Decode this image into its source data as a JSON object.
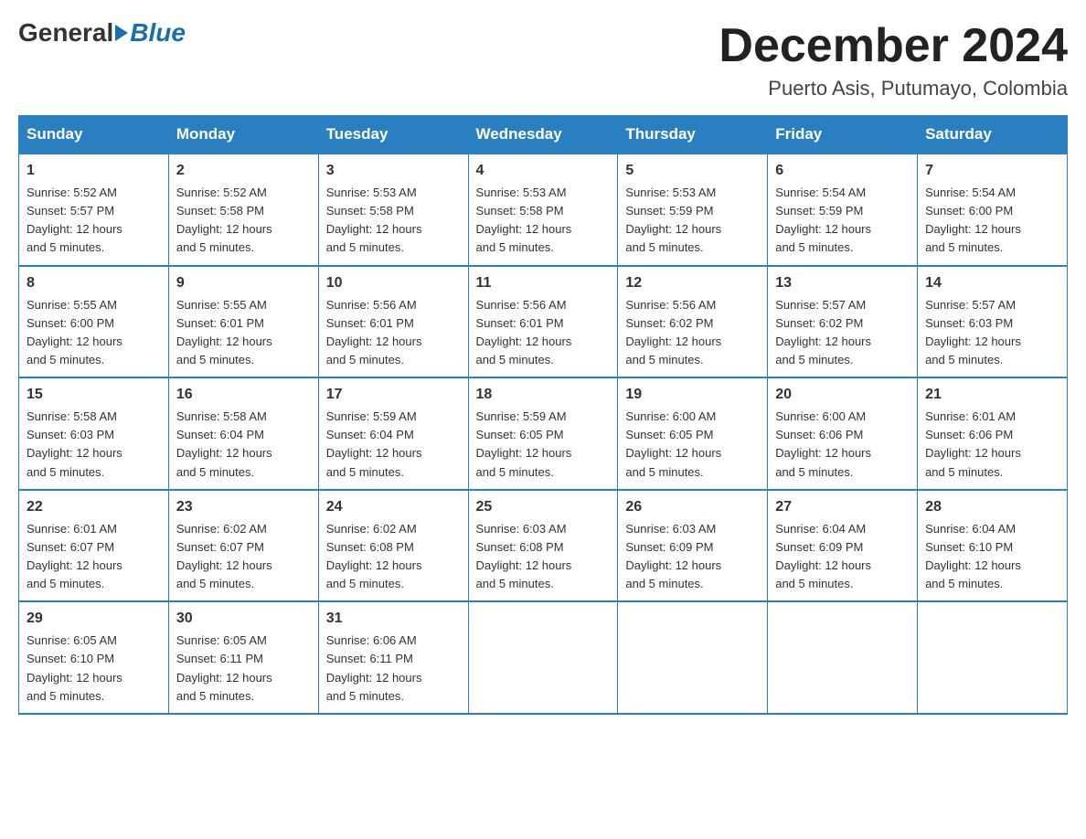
{
  "logo": {
    "general": "General",
    "blue": "Blue"
  },
  "title": "December 2024",
  "location": "Puerto Asis, Putumayo, Colombia",
  "days_header": [
    "Sunday",
    "Monday",
    "Tuesday",
    "Wednesday",
    "Thursday",
    "Friday",
    "Saturday"
  ],
  "weeks": [
    [
      {
        "day": "1",
        "sunrise": "5:52 AM",
        "sunset": "5:57 PM",
        "daylight": "12 hours and 5 minutes."
      },
      {
        "day": "2",
        "sunrise": "5:52 AM",
        "sunset": "5:58 PM",
        "daylight": "12 hours and 5 minutes."
      },
      {
        "day": "3",
        "sunrise": "5:53 AM",
        "sunset": "5:58 PM",
        "daylight": "12 hours and 5 minutes."
      },
      {
        "day": "4",
        "sunrise": "5:53 AM",
        "sunset": "5:58 PM",
        "daylight": "12 hours and 5 minutes."
      },
      {
        "day": "5",
        "sunrise": "5:53 AM",
        "sunset": "5:59 PM",
        "daylight": "12 hours and 5 minutes."
      },
      {
        "day": "6",
        "sunrise": "5:54 AM",
        "sunset": "5:59 PM",
        "daylight": "12 hours and 5 minutes."
      },
      {
        "day": "7",
        "sunrise": "5:54 AM",
        "sunset": "6:00 PM",
        "daylight": "12 hours and 5 minutes."
      }
    ],
    [
      {
        "day": "8",
        "sunrise": "5:55 AM",
        "sunset": "6:00 PM",
        "daylight": "12 hours and 5 minutes."
      },
      {
        "day": "9",
        "sunrise": "5:55 AM",
        "sunset": "6:01 PM",
        "daylight": "12 hours and 5 minutes."
      },
      {
        "day": "10",
        "sunrise": "5:56 AM",
        "sunset": "6:01 PM",
        "daylight": "12 hours and 5 minutes."
      },
      {
        "day": "11",
        "sunrise": "5:56 AM",
        "sunset": "6:01 PM",
        "daylight": "12 hours and 5 minutes."
      },
      {
        "day": "12",
        "sunrise": "5:56 AM",
        "sunset": "6:02 PM",
        "daylight": "12 hours and 5 minutes."
      },
      {
        "day": "13",
        "sunrise": "5:57 AM",
        "sunset": "6:02 PM",
        "daylight": "12 hours and 5 minutes."
      },
      {
        "day": "14",
        "sunrise": "5:57 AM",
        "sunset": "6:03 PM",
        "daylight": "12 hours and 5 minutes."
      }
    ],
    [
      {
        "day": "15",
        "sunrise": "5:58 AM",
        "sunset": "6:03 PM",
        "daylight": "12 hours and 5 minutes."
      },
      {
        "day": "16",
        "sunrise": "5:58 AM",
        "sunset": "6:04 PM",
        "daylight": "12 hours and 5 minutes."
      },
      {
        "day": "17",
        "sunrise": "5:59 AM",
        "sunset": "6:04 PM",
        "daylight": "12 hours and 5 minutes."
      },
      {
        "day": "18",
        "sunrise": "5:59 AM",
        "sunset": "6:05 PM",
        "daylight": "12 hours and 5 minutes."
      },
      {
        "day": "19",
        "sunrise": "6:00 AM",
        "sunset": "6:05 PM",
        "daylight": "12 hours and 5 minutes."
      },
      {
        "day": "20",
        "sunrise": "6:00 AM",
        "sunset": "6:06 PM",
        "daylight": "12 hours and 5 minutes."
      },
      {
        "day": "21",
        "sunrise": "6:01 AM",
        "sunset": "6:06 PM",
        "daylight": "12 hours and 5 minutes."
      }
    ],
    [
      {
        "day": "22",
        "sunrise": "6:01 AM",
        "sunset": "6:07 PM",
        "daylight": "12 hours and 5 minutes."
      },
      {
        "day": "23",
        "sunrise": "6:02 AM",
        "sunset": "6:07 PM",
        "daylight": "12 hours and 5 minutes."
      },
      {
        "day": "24",
        "sunrise": "6:02 AM",
        "sunset": "6:08 PM",
        "daylight": "12 hours and 5 minutes."
      },
      {
        "day": "25",
        "sunrise": "6:03 AM",
        "sunset": "6:08 PM",
        "daylight": "12 hours and 5 minutes."
      },
      {
        "day": "26",
        "sunrise": "6:03 AM",
        "sunset": "6:09 PM",
        "daylight": "12 hours and 5 minutes."
      },
      {
        "day": "27",
        "sunrise": "6:04 AM",
        "sunset": "6:09 PM",
        "daylight": "12 hours and 5 minutes."
      },
      {
        "day": "28",
        "sunrise": "6:04 AM",
        "sunset": "6:10 PM",
        "daylight": "12 hours and 5 minutes."
      }
    ],
    [
      {
        "day": "29",
        "sunrise": "6:05 AM",
        "sunset": "6:10 PM",
        "daylight": "12 hours and 5 minutes."
      },
      {
        "day": "30",
        "sunrise": "6:05 AM",
        "sunset": "6:11 PM",
        "daylight": "12 hours and 5 minutes."
      },
      {
        "day": "31",
        "sunrise": "6:06 AM",
        "sunset": "6:11 PM",
        "daylight": "12 hours and 5 minutes."
      },
      null,
      null,
      null,
      null
    ]
  ]
}
